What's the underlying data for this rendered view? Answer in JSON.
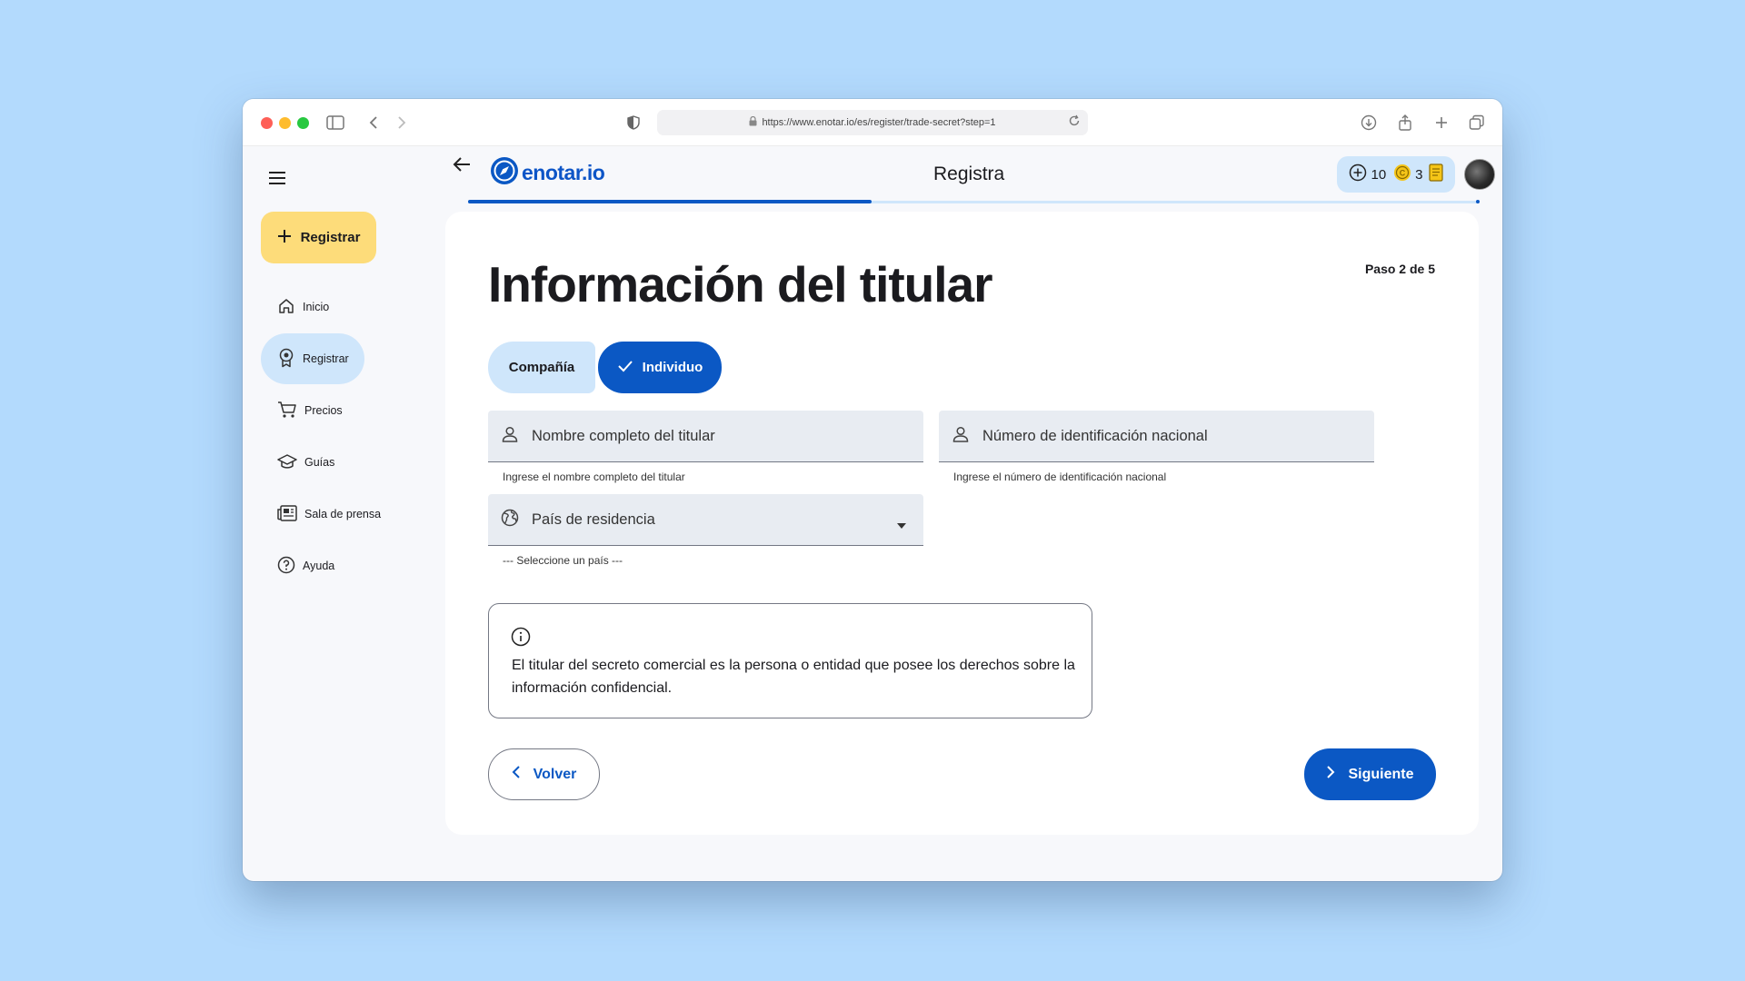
{
  "browser": {
    "url": "https://www.enotar.io/es/register/trade-secret?step=1"
  },
  "sidebar": {
    "cta_label": "Registrar",
    "items": [
      {
        "label": "Inicio",
        "icon": "home-icon",
        "active": false
      },
      {
        "label": "Registrar",
        "icon": "award-icon",
        "active": true
      },
      {
        "label": "Precios",
        "icon": "cart-icon",
        "active": false
      },
      {
        "label": "Guías",
        "icon": "graduation-cap-icon",
        "active": false
      },
      {
        "label": "Sala de prensa",
        "icon": "newspaper-icon",
        "active": false
      },
      {
        "label": "Ayuda",
        "icon": "help-circle-icon",
        "active": false
      }
    ]
  },
  "header": {
    "logo_text": "enotar.io",
    "title": "Registra",
    "credits": {
      "plus_count": "10",
      "coin_count": "3"
    },
    "progress_fraction": 0.4
  },
  "form": {
    "step": "Paso 2 de 5",
    "title": "Información del titular",
    "entity_types": [
      {
        "label": "Compañía",
        "selected": false
      },
      {
        "label": "Individuo",
        "selected": true
      }
    ],
    "full_name": {
      "placeholder": "Nombre completo del titular",
      "helper": "Ingrese el nombre completo del titular"
    },
    "national_id": {
      "placeholder": "Número de identificación nacional",
      "helper": "Ingrese el número de identificación nacional"
    },
    "country": {
      "label": "País de residencia",
      "helper": "--- Seleccione un país ---"
    },
    "info_text": "El titular del secreto comercial es la persona o entidad que posee los derechos sobre la información confidencial.",
    "back_label": "Volver",
    "next_label": "Siguiente"
  },
  "colors": {
    "primary": "#0b58c4",
    "cta_yellow": "#fddc7a",
    "light_blue": "#cfe6fb",
    "background": "#b3dafd"
  }
}
